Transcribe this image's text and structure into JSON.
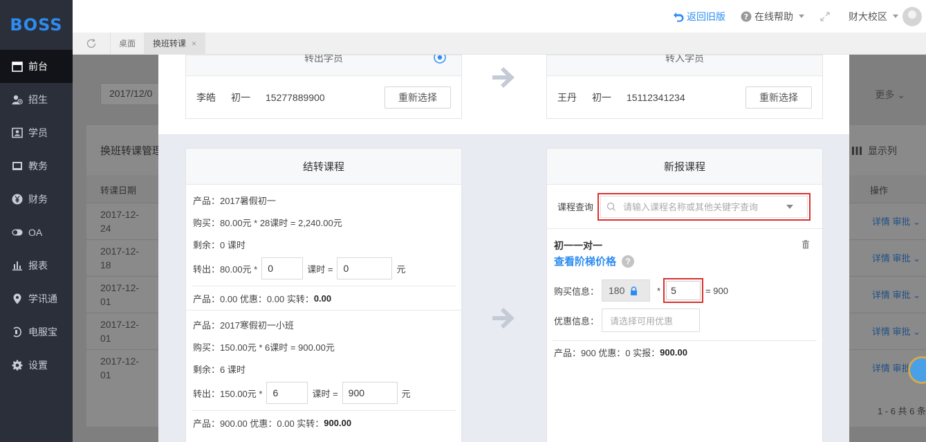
{
  "app": {
    "logo": "BOSS"
  },
  "sidebar": {
    "items": [
      {
        "label": "前台",
        "icon": "calendar-icon",
        "active": true
      },
      {
        "label": "招生",
        "icon": "user-add-icon"
      },
      {
        "label": "学员",
        "icon": "id-card-icon"
      },
      {
        "label": "教务",
        "icon": "book-icon"
      },
      {
        "label": "财务",
        "icon": "yen-icon"
      },
      {
        "label": "OA",
        "icon": "toggle-icon"
      },
      {
        "label": "报表",
        "icon": "bar-chart-icon"
      },
      {
        "label": "学讯通",
        "icon": "location-icon"
      },
      {
        "label": "电服宝",
        "icon": "headset-icon"
      },
      {
        "label": "设置",
        "icon": "gear-icon"
      }
    ]
  },
  "header": {
    "back_label": "返回旧版",
    "help_label": "在线帮助",
    "campus_label": "财大校区"
  },
  "tabs": [
    {
      "label": "桌面"
    },
    {
      "label": "换班转课",
      "close": "×"
    }
  ],
  "background": {
    "date_filter": "2017/12/0",
    "more_label": "更多",
    "panel_title": "换班转课管理",
    "show_columns": "显示列",
    "col_date": "转课日期",
    "col_action": "操作",
    "rows": [
      {
        "date": "2017-12-24"
      },
      {
        "date": "2017-12-18"
      },
      {
        "date": "2017-12-01"
      },
      {
        "date": "2017-12-01"
      },
      {
        "date": "2017-12-01"
      }
    ],
    "action_detail": "详情",
    "action_approve": "审批",
    "pager": "1 - 6  共 6 条"
  },
  "transfer_out": {
    "header": "转出学员",
    "name": "李皓",
    "grade": "初一",
    "phone": "15277889900",
    "reselect": "重新选择"
  },
  "transfer_in": {
    "header": "转入学员",
    "name": "王丹",
    "grade": "初一",
    "phone": "15112341234",
    "reselect": "重新选择"
  },
  "settle": {
    "title": "结转课程",
    "items": [
      {
        "product_label": "产品：",
        "product": "2017暑假初一",
        "buy_label": "购买：",
        "buy": "80.00元 * 28课时 = 2,240.00元",
        "remain_label": "剩余：",
        "remain": "0 课时",
        "out_label": "转出：",
        "out_price": "80.00元 *",
        "out_hours": "0",
        "hours_eq": "课时 =",
        "out_amount": "0",
        "yuan": "元",
        "summary_prefix": "产品：0.00   优惠：0.00   实转：",
        "summary_total": "0.00"
      },
      {
        "product_label": "产品：",
        "product": "2017寒假初一小班",
        "buy_label": "购买：",
        "buy": "150.00元 * 6课时 = 900.00元",
        "remain_label": "剩余：",
        "remain": "6 课时",
        "out_label": "转出：",
        "out_price": "150.00元 *",
        "out_hours": "6",
        "hours_eq": "课时 =",
        "out_amount": "900",
        "yuan": "元",
        "summary_prefix": "产品：900.00   优惠：0.00   实转：",
        "summary_total": "900.00"
      }
    ]
  },
  "new_course": {
    "title": "新报课程",
    "query_label": "课程查询",
    "query_placeholder": "请输入课程名称或其他关键字查询",
    "course_name": "初一一对一",
    "tier_link": "查看阶梯价格",
    "help_mark": "?",
    "buy_label": "购买信息：",
    "unit_price": "180",
    "multiply": "*",
    "quantity": "5",
    "equals": "= 900",
    "discount_label": "优惠信息：",
    "discount_placeholder": "请选择可用优惠",
    "summary_prefix": "产品：900   优惠：0   实报：",
    "summary_total": "900.00"
  },
  "colors": {
    "accent": "#2d8cf0",
    "highlight": "#d9302e",
    "sidebar": "#2b2f3a"
  }
}
